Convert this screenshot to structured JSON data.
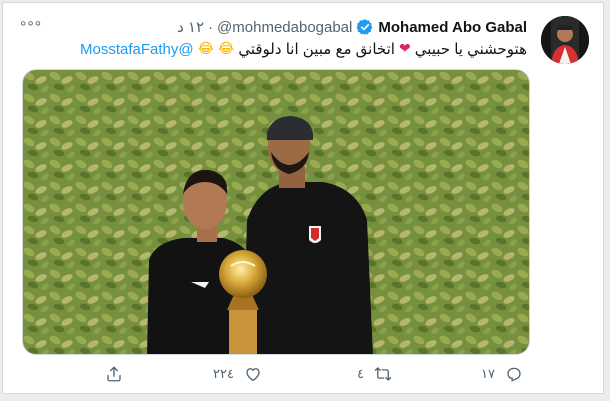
{
  "tweet": {
    "author_name": "Mohamed Abo Gabal",
    "handle": "@mohmedabogabal",
    "separator": "·",
    "time": "١٢ د",
    "text_main": "هتوحشني يا حبيبي",
    "text_after_heart": "اتخانق مع مبين انا دلوقتي",
    "mention": "@MosstafaFathy",
    "more_label": "°°°"
  },
  "actions": {
    "replies": "١٧",
    "retweets": "٤",
    "likes": "٢٢٤"
  },
  "icons": {
    "verified": "verified-badge-icon",
    "more": "more-options-icon",
    "reply": "reply-icon",
    "retweet": "retweet-icon",
    "like": "heart-icon",
    "share": "share-icon"
  },
  "colors": {
    "accent": "#1d9bf0",
    "text": "#0f1419",
    "muted": "#536471",
    "heart": "#e0245e"
  }
}
